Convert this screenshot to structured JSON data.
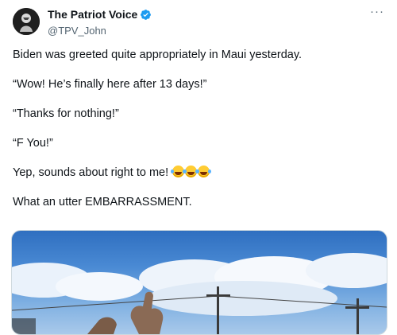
{
  "author": {
    "display_name": "The Patriot Voice",
    "handle": "@TPV_John",
    "verified": true,
    "avatar_icon": "eagle-avatar-icon"
  },
  "menu": {
    "more_label": "···"
  },
  "tweet": {
    "line1": "Biden was greeted quite appropriately in Maui yesterday.",
    "line2": "“Wow! He’s finally here after 13 days!”",
    "line3": "“Thanks for nothing!”",
    "line4": "“F You!”",
    "line5": "Yep, sounds about right to me!",
    "line5_emoji": [
      "rolling-on-floor-laughing-icon",
      "rolling-on-floor-laughing-icon",
      "rolling-on-floor-laughing-icon"
    ],
    "line6": "What an utter EMBARRASSMENT."
  },
  "colors": {
    "text": "#0f1419",
    "secondary": "#536471",
    "verified_blue": "#1d9bf0"
  }
}
